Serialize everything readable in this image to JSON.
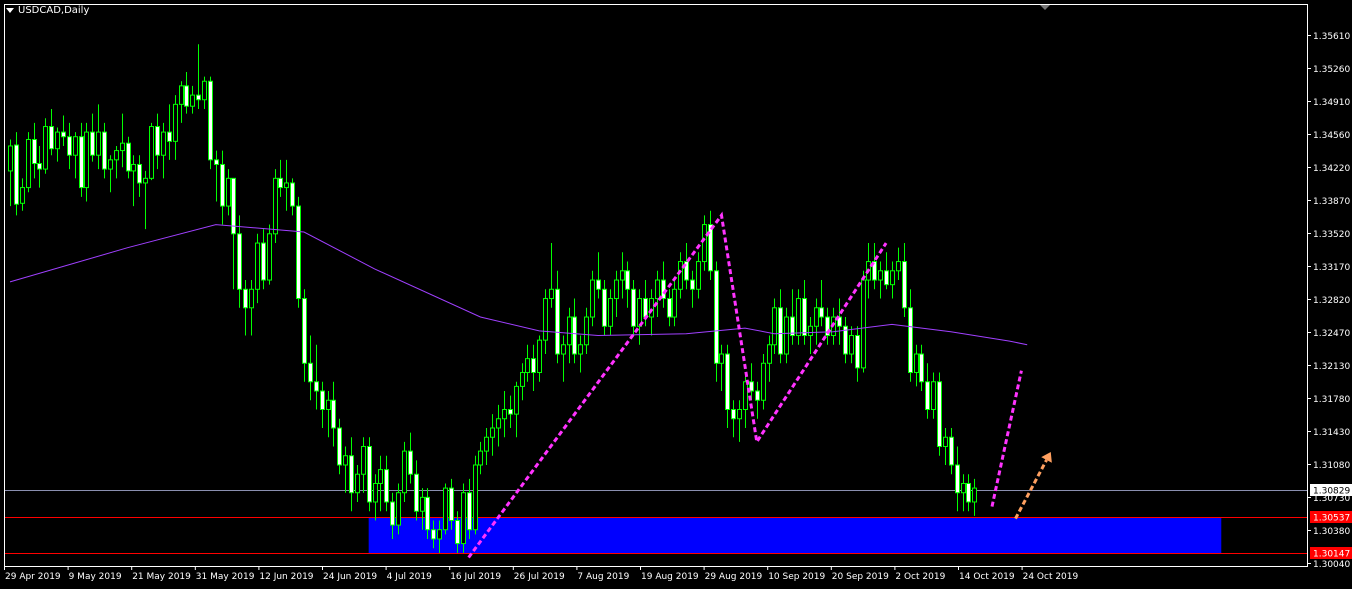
{
  "window": {
    "title": "USDCAD,Daily"
  },
  "chart_data": {
    "type": "candlestick",
    "symbol": "USDCAD",
    "timeframe": "Daily",
    "ylim": [
      1.3004,
      1.3575
    ],
    "y_ticks": [
      "1.35610",
      "1.35260",
      "1.34910",
      "1.34560",
      "1.34220",
      "1.33870",
      "1.33520",
      "1.33170",
      "1.32820",
      "1.32470",
      "1.32130",
      "1.31780",
      "1.31430",
      "1.31080",
      "1.30730",
      "1.30380",
      "1.30040"
    ],
    "x_tick_labels": [
      "29 Apr 2019",
      "9 May 2019",
      "21 May 2019",
      "31 May 2019",
      "12 Jun 2019",
      "24 Jun 2019",
      "4 Jul 2019",
      "16 Jul 2019",
      "26 Jul 2019",
      "7 Aug 2019",
      "19 Aug 2019",
      "29 Aug 2019",
      "10 Sep 2019",
      "20 Sep 2019",
      "2 Oct 2019",
      "14 Oct 2019",
      "24 Oct 2019"
    ],
    "price_labels": [
      {
        "text": "1.30829",
        "value": 1.30829,
        "color": "#ffffff",
        "text_color": "#000000"
      },
      {
        "text": "1.30537",
        "value": 1.30537,
        "color": "#ff0000",
        "text_color": "#ffffff"
      },
      {
        "text": "1.30147",
        "value": 1.30147,
        "color": "#ff0000",
        "text_color": "#ffffff"
      }
    ],
    "horizontal_lines": [
      {
        "value": 1.30829,
        "color": "#8a8fb0"
      },
      {
        "value": 1.30537,
        "color": "#ff0000"
      },
      {
        "value": 1.30147,
        "color": "#ff0000"
      }
    ],
    "support_zone": {
      "y_low": 1.30147,
      "y_high": 1.30537,
      "from_bar": 61,
      "to_bar": 206,
      "color": "#0000ff"
    },
    "ma_points": [
      [
        0,
        1.3308
      ],
      [
        20,
        1.3345
      ],
      [
        35,
        1.337
      ],
      [
        50,
        1.3362
      ],
      [
        62,
        1.3322
      ],
      [
        80,
        1.327
      ],
      [
        90,
        1.3255
      ],
      [
        100,
        1.325
      ],
      [
        115,
        1.3252
      ],
      [
        125,
        1.3258
      ],
      [
        130,
        1.3252
      ],
      [
        140,
        1.3254
      ],
      [
        150,
        1.3262
      ],
      [
        160,
        1.3254
      ],
      [
        170,
        1.3244
      ],
      [
        173,
        1.324
      ]
    ],
    "zigzag": [
      [
        78,
        1.301
      ],
      [
        121,
        1.338
      ],
      [
        127,
        1.3135
      ],
      [
        149,
        1.335
      ],
      [
        167,
        1.3065
      ],
      [
        172,
        1.3212
      ]
    ],
    "zigzag_split": 2,
    "arrow": {
      "from": [
        171,
        1.3052
      ],
      "to": [
        177,
        1.3124
      ],
      "color": "#ffa060"
    },
    "candles": [
      [
        1.3428,
        1.3462,
        1.339,
        1.3455
      ],
      [
        1.3456,
        1.347,
        1.338,
        1.3392
      ],
      [
        1.3393,
        1.342,
        1.3385,
        1.341
      ],
      [
        1.341,
        1.347,
        1.3405,
        1.3462
      ],
      [
        1.3462,
        1.348,
        1.342,
        1.3436
      ],
      [
        1.3436,
        1.3455,
        1.341,
        1.343
      ],
      [
        1.343,
        1.3485,
        1.3425,
        1.3476
      ],
      [
        1.3476,
        1.3495,
        1.3445,
        1.3452
      ],
      [
        1.3452,
        1.3475,
        1.3438,
        1.347
      ],
      [
        1.347,
        1.3488,
        1.3455,
        1.3465
      ],
      [
        1.3465,
        1.348,
        1.343,
        1.3445
      ],
      [
        1.3445,
        1.347,
        1.342,
        1.3465
      ],
      [
        1.3465,
        1.348,
        1.34,
        1.341
      ],
      [
        1.341,
        1.348,
        1.3395,
        1.347
      ],
      [
        1.347,
        1.349,
        1.3438,
        1.3445
      ],
      [
        1.3445,
        1.35,
        1.343,
        1.347
      ],
      [
        1.347,
        1.348,
        1.342,
        1.343
      ],
      [
        1.343,
        1.3445,
        1.3405,
        1.344
      ],
      [
        1.344,
        1.3455,
        1.342,
        1.345
      ],
      [
        1.345,
        1.349,
        1.3432,
        1.3458
      ],
      [
        1.3458,
        1.3465,
        1.342,
        1.3428
      ],
      [
        1.3428,
        1.3445,
        1.339,
        1.3435
      ],
      [
        1.3435,
        1.3445,
        1.34,
        1.3415
      ],
      [
        1.3415,
        1.3428,
        1.3365,
        1.342
      ],
      [
        1.342,
        1.348,
        1.3418,
        1.3476
      ],
      [
        1.3476,
        1.349,
        1.343,
        1.3445
      ],
      [
        1.3445,
        1.348,
        1.342,
        1.347
      ],
      [
        1.347,
        1.35,
        1.344,
        1.346
      ],
      [
        1.346,
        1.351,
        1.344,
        1.35
      ],
      [
        1.35,
        1.3525,
        1.348,
        1.352
      ],
      [
        1.352,
        1.3535,
        1.349,
        1.3498
      ],
      [
        1.3498,
        1.352,
        1.349,
        1.351
      ],
      [
        1.351,
        1.3565,
        1.3495,
        1.3505
      ],
      [
        1.3505,
        1.353,
        1.3495,
        1.3525
      ],
      [
        1.3525,
        1.353,
        1.343,
        1.344
      ],
      [
        1.344,
        1.345,
        1.3395,
        1.3435
      ],
      [
        1.3435,
        1.345,
        1.337,
        1.339
      ],
      [
        1.339,
        1.343,
        1.338,
        1.342
      ],
      [
        1.342,
        1.342,
        1.33,
        1.336
      ],
      [
        1.336,
        1.338,
        1.328,
        1.33
      ],
      [
        1.33,
        1.331,
        1.325,
        1.328
      ],
      [
        1.328,
        1.331,
        1.325,
        1.33
      ],
      [
        1.33,
        1.336,
        1.3285,
        1.335
      ],
      [
        1.335,
        1.3365,
        1.33,
        1.331
      ],
      [
        1.331,
        1.337,
        1.3305,
        1.336
      ],
      [
        1.336,
        1.343,
        1.335,
        1.342
      ],
      [
        1.342,
        1.344,
        1.34,
        1.341
      ],
      [
        1.341,
        1.344,
        1.3385,
        1.3415
      ],
      [
        1.3415,
        1.342,
        1.338,
        1.339
      ],
      [
        1.339,
        1.34,
        1.328,
        1.329
      ],
      [
        1.329,
        1.33,
        1.32,
        1.322
      ],
      [
        1.322,
        1.325,
        1.318,
        1.32
      ],
      [
        1.32,
        1.324,
        1.317,
        1.319
      ],
      [
        1.319,
        1.32,
        1.315,
        1.317
      ],
      [
        1.317,
        1.319,
        1.314,
        1.318
      ],
      [
        1.318,
        1.32,
        1.313,
        1.315
      ],
      [
        1.315,
        1.316,
        1.31,
        1.311
      ],
      [
        1.311,
        1.313,
        1.308,
        1.312
      ],
      [
        1.312,
        1.314,
        1.306,
        1.308
      ],
      [
        1.308,
        1.311,
        1.307,
        1.31
      ],
      [
        1.31,
        1.314,
        1.308,
        1.313
      ],
      [
        1.313,
        1.314,
        1.306,
        1.307
      ],
      [
        1.307,
        1.31,
        1.305,
        1.309
      ],
      [
        1.309,
        1.312,
        1.306,
        1.3105
      ],
      [
        1.3105,
        1.312,
        1.306,
        1.307
      ],
      [
        1.307,
        1.308,
        1.303,
        1.3045
      ],
      [
        1.3045,
        1.309,
        1.3035,
        1.308
      ],
      [
        1.308,
        1.3135,
        1.307,
        1.3125
      ],
      [
        1.3125,
        1.3145,
        1.309,
        1.31
      ],
      [
        1.31,
        1.3115,
        1.305,
        1.306
      ],
      [
        1.306,
        1.3085,
        1.304,
        1.3075
      ],
      [
        1.3075,
        1.3085,
        1.303,
        1.304
      ],
      [
        1.304,
        1.305,
        1.302,
        1.303
      ],
      [
        1.303,
        1.305,
        1.3015,
        1.304
      ],
      [
        1.304,
        1.309,
        1.3035,
        1.3085
      ],
      [
        1.3085,
        1.3095,
        1.304,
        1.305
      ],
      [
        1.305,
        1.306,
        1.3015,
        1.3025
      ],
      [
        1.3025,
        1.309,
        1.3015,
        1.308
      ],
      [
        1.308,
        1.3095,
        1.303,
        1.304
      ],
      [
        1.304,
        1.312,
        1.3035,
        1.311
      ],
      [
        1.311,
        1.3135,
        1.31,
        1.3125
      ],
      [
        1.3125,
        1.315,
        1.311,
        1.314
      ],
      [
        1.314,
        1.3165,
        1.312,
        1.315
      ],
      [
        1.315,
        1.3175,
        1.313,
        1.316
      ],
      [
        1.316,
        1.319,
        1.314,
        1.317
      ],
      [
        1.317,
        1.3185,
        1.315,
        1.3165
      ],
      [
        1.3165,
        1.32,
        1.314,
        1.3195
      ],
      [
        1.3195,
        1.322,
        1.318,
        1.321
      ],
      [
        1.321,
        1.324,
        1.32,
        1.3225
      ],
      [
        1.3225,
        1.324,
        1.319,
        1.321
      ],
      [
        1.321,
        1.325,
        1.32,
        1.3245
      ],
      [
        1.3245,
        1.33,
        1.323,
        1.329
      ],
      [
        1.329,
        1.335,
        1.328,
        1.33
      ],
      [
        1.33,
        1.332,
        1.322,
        1.323
      ],
      [
        1.323,
        1.325,
        1.32,
        1.324
      ],
      [
        1.324,
        1.328,
        1.322,
        1.327
      ],
      [
        1.327,
        1.329,
        1.322,
        1.323
      ],
      [
        1.323,
        1.325,
        1.321,
        1.324
      ],
      [
        1.324,
        1.328,
        1.323,
        1.327
      ],
      [
        1.327,
        1.332,
        1.326,
        1.331
      ],
      [
        1.331,
        1.334,
        1.329,
        1.33
      ],
      [
        1.33,
        1.331,
        1.325,
        1.326
      ],
      [
        1.326,
        1.33,
        1.325,
        1.329
      ],
      [
        1.329,
        1.332,
        1.327,
        1.331
      ],
      [
        1.331,
        1.334,
        1.329,
        1.332
      ],
      [
        1.332,
        1.333,
        1.328,
        1.33
      ],
      [
        1.33,
        1.331,
        1.325,
        1.326
      ],
      [
        1.326,
        1.33,
        1.324,
        1.329
      ],
      [
        1.329,
        1.331,
        1.326,
        1.327
      ],
      [
        1.327,
        1.33,
        1.325,
        1.329
      ],
      [
        1.329,
        1.332,
        1.327,
        1.331
      ],
      [
        1.331,
        1.333,
        1.328,
        1.329
      ],
      [
        1.329,
        1.33,
        1.326,
        1.327
      ],
      [
        1.327,
        1.331,
        1.326,
        1.33
      ],
      [
        1.33,
        1.334,
        1.329,
        1.333
      ],
      [
        1.333,
        1.335,
        1.33,
        1.331
      ],
      [
        1.331,
        1.332,
        1.328,
        1.33
      ],
      [
        1.33,
        1.334,
        1.329,
        1.333
      ],
      [
        1.333,
        1.338,
        1.332,
        1.337
      ],
      [
        1.337,
        1.3385,
        1.331,
        1.332
      ],
      [
        1.332,
        1.333,
        1.32,
        1.322
      ],
      [
        1.322,
        1.324,
        1.319,
        1.323
      ],
      [
        1.323,
        1.324,
        1.315,
        1.317
      ],
      [
        1.317,
        1.318,
        1.314,
        1.316
      ],
      [
        1.316,
        1.318,
        1.3135,
        1.317
      ],
      [
        1.317,
        1.321,
        1.315,
        1.32
      ],
      [
        1.32,
        1.322,
        1.318,
        1.319
      ],
      [
        1.319,
        1.32,
        1.316,
        1.318
      ],
      [
        1.318,
        1.323,
        1.317,
        1.322
      ],
      [
        1.322,
        1.325,
        1.32,
        1.324
      ],
      [
        1.324,
        1.329,
        1.323,
        1.328
      ],
      [
        1.328,
        1.33,
        1.322,
        1.323
      ],
      [
        1.323,
        1.328,
        1.322,
        1.327
      ],
      [
        1.327,
        1.33,
        1.324,
        1.325
      ],
      [
        1.325,
        1.33,
        1.324,
        1.329
      ],
      [
        1.329,
        1.331,
        1.324,
        1.325
      ],
      [
        1.325,
        1.327,
        1.323,
        1.326
      ],
      [
        1.326,
        1.329,
        1.324,
        1.328
      ],
      [
        1.328,
        1.331,
        1.326,
        1.327
      ],
      [
        1.327,
        1.328,
        1.324,
        1.325
      ],
      [
        1.325,
        1.328,
        1.324,
        1.327
      ],
      [
        1.327,
        1.329,
        1.324,
        1.326
      ],
      [
        1.326,
        1.327,
        1.322,
        1.323
      ],
      [
        1.323,
        1.326,
        1.322,
        1.325
      ],
      [
        1.325,
        1.326,
        1.32,
        1.3215
      ],
      [
        1.3215,
        1.332,
        1.321,
        1.331
      ],
      [
        1.331,
        1.335,
        1.329,
        1.333
      ],
      [
        1.333,
        1.335,
        1.33,
        1.331
      ],
      [
        1.331,
        1.333,
        1.329,
        1.332
      ],
      [
        1.332,
        1.334,
        1.33,
        1.3305
      ],
      [
        1.3305,
        1.333,
        1.329,
        1.332
      ],
      [
        1.332,
        1.3345,
        1.331,
        1.333
      ],
      [
        1.333,
        1.335,
        1.327,
        1.328
      ],
      [
        1.328,
        1.33,
        1.32,
        1.321
      ],
      [
        1.321,
        1.324,
        1.3195,
        1.323
      ],
      [
        1.323,
        1.324,
        1.319,
        1.32
      ],
      [
        1.32,
        1.322,
        1.316,
        1.317
      ],
      [
        1.317,
        1.321,
        1.316,
        1.32
      ],
      [
        1.32,
        1.321,
        1.312,
        1.313
      ],
      [
        1.313,
        1.315,
        1.311,
        1.314
      ],
      [
        1.314,
        1.315,
        1.31,
        1.311
      ],
      [
        1.311,
        1.313,
        1.306,
        1.308
      ],
      [
        1.308,
        1.31,
        1.306,
        1.309
      ],
      [
        1.309,
        1.31,
        1.306,
        1.307
      ],
      [
        1.307,
        1.3095,
        1.3055,
        1.3085
      ]
    ]
  }
}
